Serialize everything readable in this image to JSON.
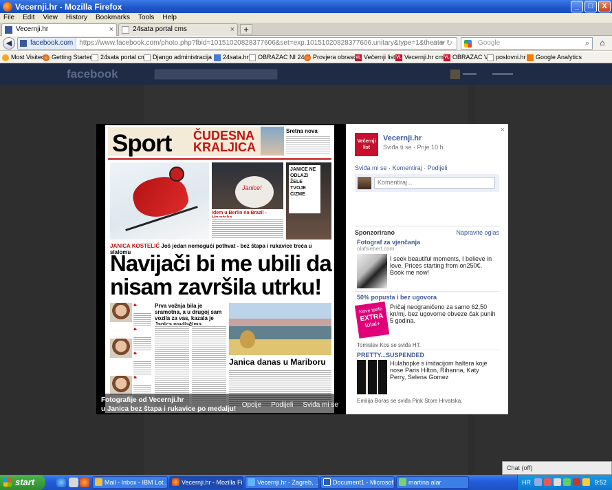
{
  "window": {
    "title": "Vecernji.hr - Mozilla Firefox",
    "buttons": {
      "minimize": "_",
      "maximize": "□",
      "close": "X"
    }
  },
  "menu": [
    "File",
    "Edit",
    "View",
    "History",
    "Bookmarks",
    "Tools",
    "Help"
  ],
  "tabs": [
    {
      "label": "Vecernji.hr",
      "active": true
    },
    {
      "label": "24sata portal cms",
      "active": false
    }
  ],
  "nav": {
    "site_badge": "facebook.com",
    "url": "https://www.facebook.com/photo.php?fbid=10151020828377606&set=exp.10151020828377606.unitary&type=1&theater",
    "search_placeholder": "Google"
  },
  "bookmarks": [
    {
      "label": "Most Visited",
      "icon": "star"
    },
    {
      "label": "Getting Started",
      "icon": "firefox"
    },
    {
      "label": "24sata portal cms",
      "icon": "page"
    },
    {
      "label": "Django administracija ...",
      "icon": "page"
    },
    {
      "label": "24sata.hr",
      "icon": "blue"
    },
    {
      "label": "OBRAZAC NI 24 H",
      "icon": "page"
    },
    {
      "label": "Provjera obrasca",
      "icon": "firefox"
    },
    {
      "label": "Večernji list",
      "icon": "vl"
    },
    {
      "label": "Vecernji.hr cms",
      "icon": "vl"
    },
    {
      "label": "OBRAZAC VL",
      "icon": "vl"
    },
    {
      "label": "poslovni.hr",
      "icon": "page"
    },
    {
      "label": "Google Analytics",
      "icon": "ga"
    }
  ],
  "facebook": {
    "logo": "facebook"
  },
  "theater": {
    "newspaper": {
      "section": "Sport",
      "feature_title_line1": "ČUDESNA",
      "feature_title_line2": "KRALJICA",
      "sidebar_title": "Sretna nova godina!",
      "kicker_name": "JANICA KOSTELIĆ",
      "kicker_text": "Još jedan nemogući pothvat - bez štapa i rukavice treća u slalomu",
      "headline": "Navijači bi me ubili da nisam završila utrku!",
      "sub_item": "Idem u Berlin na Brazil - Hrvatska",
      "disc_text": "Janice!",
      "sign_text": "JANICE NE ODLAZI ŽELE TVOJE ČIZME",
      "quote_mark": "❝",
      "quote_headline": "Prva vožnja bila je sramotna, a u drugoj sam vozila za vas, kazala je Janica navijačima",
      "second_story": "Janica danas u Mariboru"
    },
    "caption": {
      "album": "Fotografije od Vecernji.hr",
      "photo_title": "u Janica bez štapa i rukavice po medalju!"
    },
    "caption_actions": [
      "Opcije",
      "Podijeli",
      "Sviđa mi se"
    ],
    "close": "×"
  },
  "panel": {
    "page_name": "Vecernji.hr",
    "logo_text": "Večernji list",
    "meta": "Sviđa ti se · Prije 10 h",
    "actions": [
      "Sviđa mi se",
      "Komentiraj",
      "Podijeli"
    ],
    "comment_placeholder": "Komentiraj...",
    "close": "×",
    "sponsored_title": "Sponzorirano",
    "create_ad": "Napravite oglas",
    "ads": [
      {
        "title": "Fotograf za vjenčanja",
        "url": "olafsiebert.com",
        "body": "I seek beautiful moments, I believe in love. Prices starting from on250€. Book me now!"
      },
      {
        "title": "50% popusta i bez ugovora",
        "url": "",
        "badge_lines": [
          "Nove tarife",
          "EXTRA",
          "total+"
        ],
        "body": "Pričaj neograničeno za samo 62,50 kn/mj. bez ugovorne obveze čak punih 5 godina.",
        "social": "Tomislav Kos se sviđa HT."
      },
      {
        "title": "PRETTY...SUSPENDED",
        "url": "",
        "body": "Hulahopke s imitacijom haltera koje nose Paris Hilton, Rihanna, Katy Perry, Selena Gomez",
        "social": "Emilija Boras se sviđa Pink Store Hrvatska."
      }
    ]
  },
  "chat": "Chat (off)",
  "taskbar": {
    "start": "start",
    "items": [
      {
        "label": "Mail - Inbox - IBM Lot...",
        "active": false
      },
      {
        "label": "Vecernji.hr - Mozilla Fi...",
        "active": true
      },
      {
        "label": "Vecernji.hr - Zagreb, ...",
        "active": false
      },
      {
        "label": "Document1 - Microsof...",
        "active": false
      },
      {
        "label": "martina alar",
        "active": false
      }
    ],
    "language": "HR",
    "clock": "9:52"
  }
}
